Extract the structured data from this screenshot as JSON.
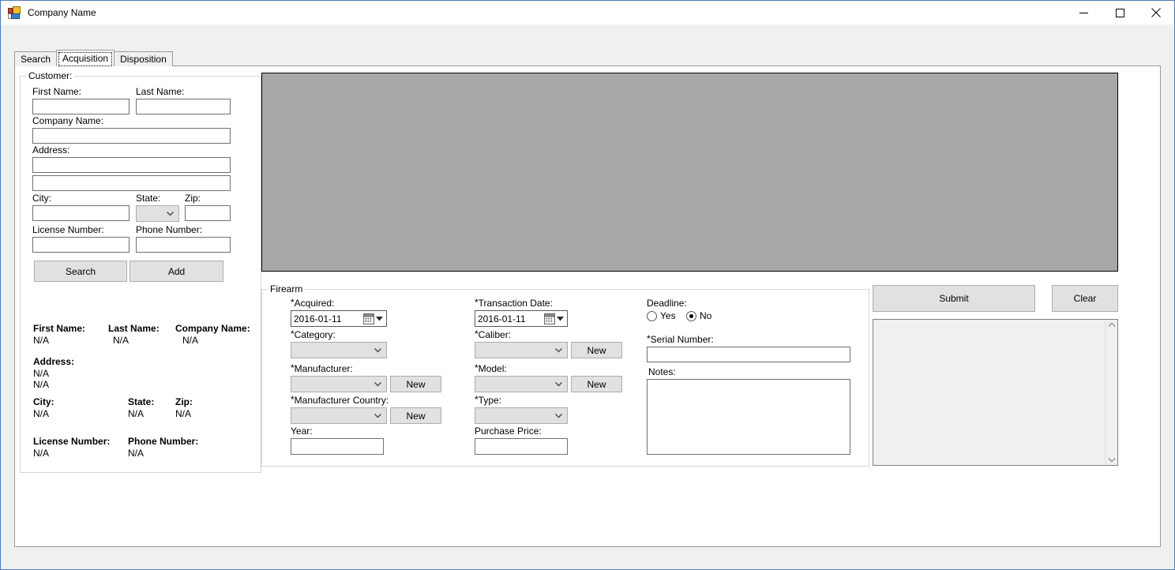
{
  "window": {
    "title": "Company Name",
    "icon": "app-icon",
    "controls": {
      "minimize": "minimize-icon",
      "maximize": "maximize-icon",
      "close": "close-icon"
    }
  },
  "tabs": [
    {
      "label": "Search",
      "active": false
    },
    {
      "label": "Acquisition",
      "active": true
    },
    {
      "label": "Disposition",
      "active": false
    }
  ],
  "customer": {
    "legend": "Customer:",
    "first_name_label": "First Name:",
    "first_name_value": "",
    "last_name_label": "Last Name:",
    "last_name_value": "",
    "company_name_label": "Company Name:",
    "company_name_value": "",
    "address_label": "Address:",
    "address1_value": "",
    "address2_value": "",
    "city_label": "City:",
    "city_value": "",
    "state_label": "State:",
    "state_value": "",
    "zip_label": "Zip:",
    "zip_value": "",
    "license_label": "License Number:",
    "license_value": "",
    "phone_label": "Phone Number:",
    "phone_value": "",
    "search_button": "Search",
    "add_button": "Add"
  },
  "summary": {
    "first_name_label": "First Name:",
    "first_name_value": "N/A",
    "last_name_label": "Last Name:",
    "last_name_value": "N/A",
    "company_name_label": "Company Name:",
    "company_name_value": "N/A",
    "address_label": "Address:",
    "address1_value": "N/A",
    "address2_value": "N/A",
    "city_label": "City:",
    "city_value": "N/A",
    "state_label": "State:",
    "state_value": "N/A",
    "zip_label": "Zip:",
    "zip_value": "N/A",
    "license_label": "License Number:",
    "license_value": "N/A",
    "phone_label": "Phone Number:",
    "phone_value": "N/A"
  },
  "firearm": {
    "legend": "Firearm",
    "acquired_label": "Acquired:",
    "acquired_value": "2016-01-11",
    "category_label": "Category:",
    "category_value": "",
    "manufacturer_label": "Manufacturer:",
    "manufacturer_value": "",
    "manufacturer_new_button": "New",
    "manufacturer_country_label": "Manufacturer Country:",
    "manufacturer_country_value": "",
    "manufacturer_country_new_button": "New",
    "year_label": "Year:",
    "year_value": "",
    "transaction_date_label": "Transaction Date:",
    "transaction_date_value": "2016-01-11",
    "caliber_label": "Caliber:",
    "caliber_value": "",
    "caliber_new_button": "New",
    "model_label": "Model:",
    "model_value": "",
    "model_new_button": "New",
    "type_label": "Type:",
    "type_value": "",
    "purchase_price_label": "Purchase Price:",
    "purchase_price_value": "",
    "deadline_label": "Deadline:",
    "deadline_yes": "Yes",
    "deadline_no": "No",
    "deadline_selected": "No",
    "serial_number_label": "Serial Number:",
    "serial_number_value": "",
    "notes_label": "Notes:",
    "notes_value": "",
    "required_marker": "*"
  },
  "actions": {
    "submit_button": "Submit",
    "clear_button": "Clear"
  },
  "log_panel": {
    "content": "",
    "scroll_up_icon": "chevron-up-icon",
    "scroll_down_icon": "chevron-down-icon"
  },
  "colors": {
    "window_border": "#4f7ab5",
    "form_background": "#f0f0f0",
    "page_background": "#ffffff",
    "picture_placeholder": "#a8a8a8",
    "control_face": "#e1e1e1",
    "groupbox_border": "#d5d5d5"
  }
}
